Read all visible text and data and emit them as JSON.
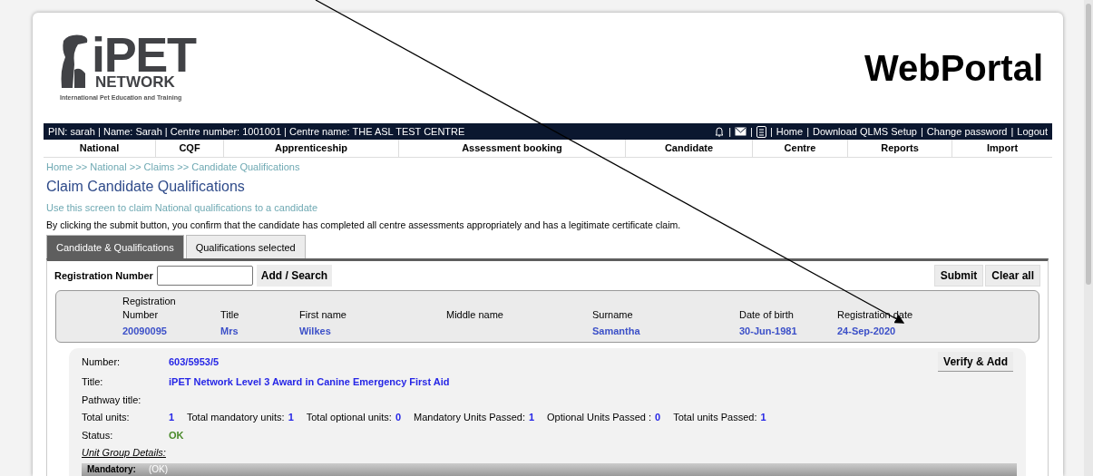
{
  "logo": {
    "brand": "iPET",
    "sub": "NETWORK",
    "tagline": "International Pet Education and Training"
  },
  "portal_title": "WebPortal",
  "user_bar": {
    "info": "PIN: sarah | Name: Sarah | Centre number: 1001001 | Centre name: THE ASL TEST CENTRE",
    "items": [
      {
        "kind": "bell"
      },
      {
        "kind": "separator",
        "text": "|"
      },
      {
        "kind": "mail"
      },
      {
        "kind": "separator",
        "text": "|"
      },
      {
        "kind": "document"
      },
      {
        "kind": "separator",
        "text": "|"
      },
      {
        "kind": "link",
        "text": "Home"
      },
      {
        "kind": "separator",
        "text": "|"
      },
      {
        "kind": "link",
        "text": "Download QLMS Setup"
      },
      {
        "kind": "separator",
        "text": "|"
      },
      {
        "kind": "link",
        "text": "Change password"
      },
      {
        "kind": "separator",
        "text": "|"
      },
      {
        "kind": "link",
        "text": "Logout"
      }
    ]
  },
  "nav": [
    "National",
    "CQF",
    "Apprenticeship",
    "Assessment booking",
    "Candidate",
    "Centre",
    "Reports",
    "Import"
  ],
  "breadcrumb": "Home >> National >> Claims >> Candidate Qualifications",
  "page_title": "Claim Candidate Qualifications",
  "subtitle": "Use this screen to claim National qualifications to a candidate",
  "notice": "By clicking the submit button, you confirm that the candidate has completed all centre assessments appropriately and has a legitimate certificate claim.",
  "tabs": [
    {
      "label": "Candidate & Qualifications",
      "selected": true
    },
    {
      "label": "Qualifications selected",
      "selected": false
    }
  ],
  "registration": {
    "label": "Registration Number",
    "search_button": "Add / Search"
  },
  "actions": [
    "Submit",
    "Clear all"
  ],
  "candidate": {
    "columns": [
      {
        "header": "Registration Number",
        "value": "20090095"
      },
      {
        "header": "Title",
        "value": "Mrs"
      },
      {
        "header": "First name",
        "value": "Wilkes"
      },
      {
        "header": "Middle name"
      },
      {
        "header": "Surname",
        "value": "Samantha"
      },
      {
        "header": "Date of birth",
        "value": "30-Jun-1981"
      },
      {
        "header": "Registration date",
        "value": "24-Sep-2020"
      }
    ]
  },
  "qualification": {
    "number_label": "Number:",
    "number": "603/5953/5",
    "verify_button": "Verify & Add",
    "title_label": "Title:",
    "title": "iPET Network Level 3 Award in Canine Emergency First Aid",
    "pathway_label": "Pathway title:",
    "totals": [
      {
        "label": "Total units:",
        "value": "1"
      },
      {
        "label": "Total mandatory units:",
        "value": "1"
      },
      {
        "label": "Total optional units:",
        "value": "0"
      },
      {
        "label": "Mandatory Units Passed:",
        "value": "1"
      },
      {
        "label": "Optional Units Passed :",
        "value": "0"
      },
      {
        "label": "Total units Passed:",
        "value": "1"
      }
    ],
    "status_label": "Status:",
    "status": "OK",
    "unit_group_label": "Unit Group Details:",
    "group": {
      "name": "Mandatory:",
      "status": "(OK)"
    }
  }
}
